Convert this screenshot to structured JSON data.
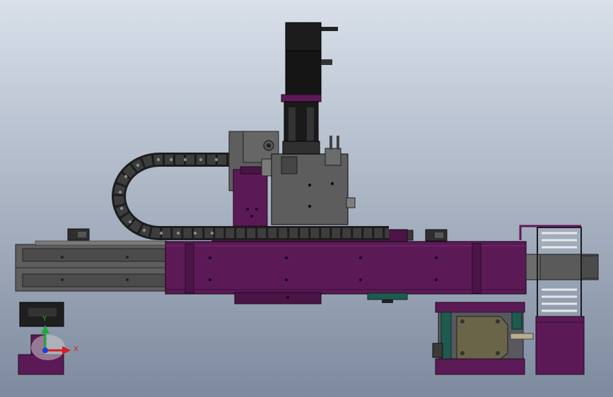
{
  "app": {
    "view": "cad-model-viewport"
  },
  "triad": {
    "x_label": "X",
    "y_label": "Y",
    "x_color": "#d81e1e",
    "y_color": "#1fa83a",
    "z_color": "#1c3fd6"
  },
  "colors": {
    "body_purple": "#5b1a55",
    "body_purple_dark": "#3c0f38",
    "rail_gray": "#6d6d6d",
    "servo_black": "#151515",
    "bracket_gray": "#585858",
    "chain_gray": "#3a3a3a",
    "block_green": "#1f5a50",
    "gearbox_olive": "#6a6548"
  }
}
